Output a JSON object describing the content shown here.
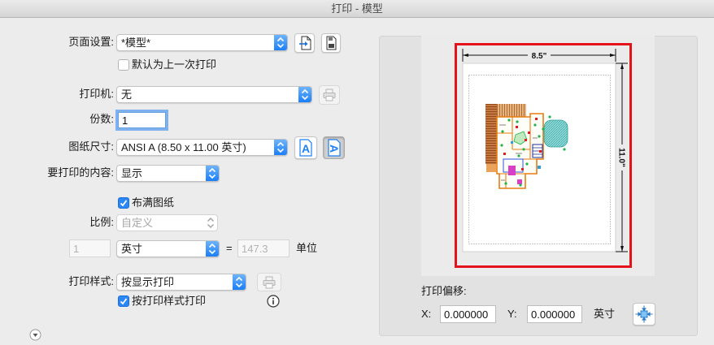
{
  "window": {
    "title": "打印 - 模型"
  },
  "colors": {
    "accent": "#1f80f9",
    "highlight_frame": "#e3121b",
    "window_bg": "#ececec"
  },
  "page_setup": {
    "label": "页面设置:",
    "value": "*模型*",
    "import_icon": "import-page-setup-icon",
    "save_icon": "save-page-setup-icon",
    "default_last": {
      "label": "默认为上一次打印",
      "checked": false
    }
  },
  "printer": {
    "label": "打印机:",
    "value": "无",
    "properties_icon": "printer-properties-icon",
    "properties_enabled": false
  },
  "copies": {
    "label": "份数:",
    "value": "1"
  },
  "paper_size": {
    "label": "图纸尺寸:",
    "value": "ANSI A (8.50 x 11.00 英寸)",
    "portrait": {
      "icon": "portrait-orientation-icon",
      "glyph": "A",
      "pressed": false
    },
    "landscape": {
      "icon": "landscape-orientation-icon",
      "glyph": "A",
      "pressed": true
    }
  },
  "what_to_print": {
    "label": "要打印的内容:",
    "value": "显示"
  },
  "fit_to_paper": {
    "label": "布满图纸",
    "checked": true
  },
  "scale": {
    "label": "比例:",
    "value": "自定义",
    "enabled": false,
    "paper_units": "1",
    "unit": "英寸",
    "equals": "=",
    "drawing_units": "147.3",
    "drawing_units_label": "单位"
  },
  "plot_style": {
    "label": "打印样式:",
    "value": "按显示打印",
    "editor_icon": "plot-style-editor-icon",
    "editor_enabled": false,
    "use_plot_styles": {
      "label": "按打印样式打印",
      "checked": true
    },
    "info_icon": "info-icon"
  },
  "details_toggle": {
    "icon": "disclosure-down-icon"
  },
  "preview": {
    "width_label": "8.5\"",
    "height_label": "11.0\""
  },
  "plot_offset": {
    "label": "打印偏移:",
    "x_label": "X:",
    "x_value": "0.000000",
    "y_label": "Y:",
    "y_value": "0.000000",
    "unit": "英寸",
    "center_icon": "center-plot-icon"
  }
}
